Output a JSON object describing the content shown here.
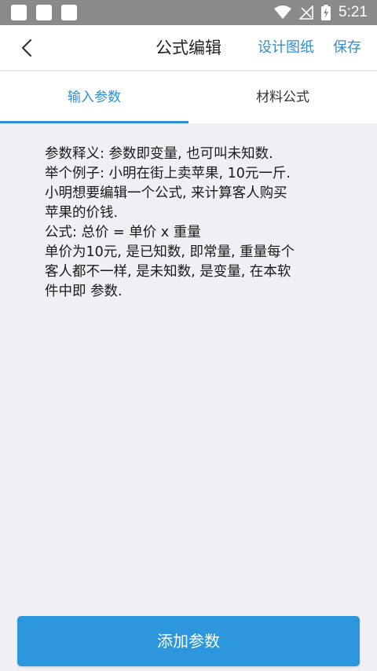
{
  "status_bar": {
    "time": "5:21",
    "icons": [
      "notification-square-icon",
      "notification-square-icon",
      "notification-square-icon",
      "wifi-icon",
      "no-signal-icon",
      "battery-charging-icon"
    ]
  },
  "app_bar": {
    "title": "公式编辑",
    "back_icon": "chevron-left-icon",
    "design_label": "设计图纸",
    "save_label": "保存"
  },
  "tabs": [
    {
      "label": "输入参数",
      "active": true
    },
    {
      "label": "材料公式",
      "active": false
    }
  ],
  "content": {
    "lines": [
      "参数释义: 参数即变量, 也可叫未知数.",
      "举个例子: 小明在街上卖苹果, 10元一斤.",
      "小明想要编辑一个公式, 来计算客人购买",
      "苹果的价钱.",
      "公式: 总价 = 单价 x 重量",
      "单价为10元, 是已知数, 即常量, 重量每个",
      "客人都不一样, 是未知数, 是变量, 在本软",
      "件中即 参数."
    ]
  },
  "bottom_button": {
    "label": "添加参数"
  },
  "colors": {
    "accent": "#2f8ed6",
    "button": "#2d97dd",
    "status_bar": "#8a8a8a",
    "page_bg": "#efeff4"
  }
}
